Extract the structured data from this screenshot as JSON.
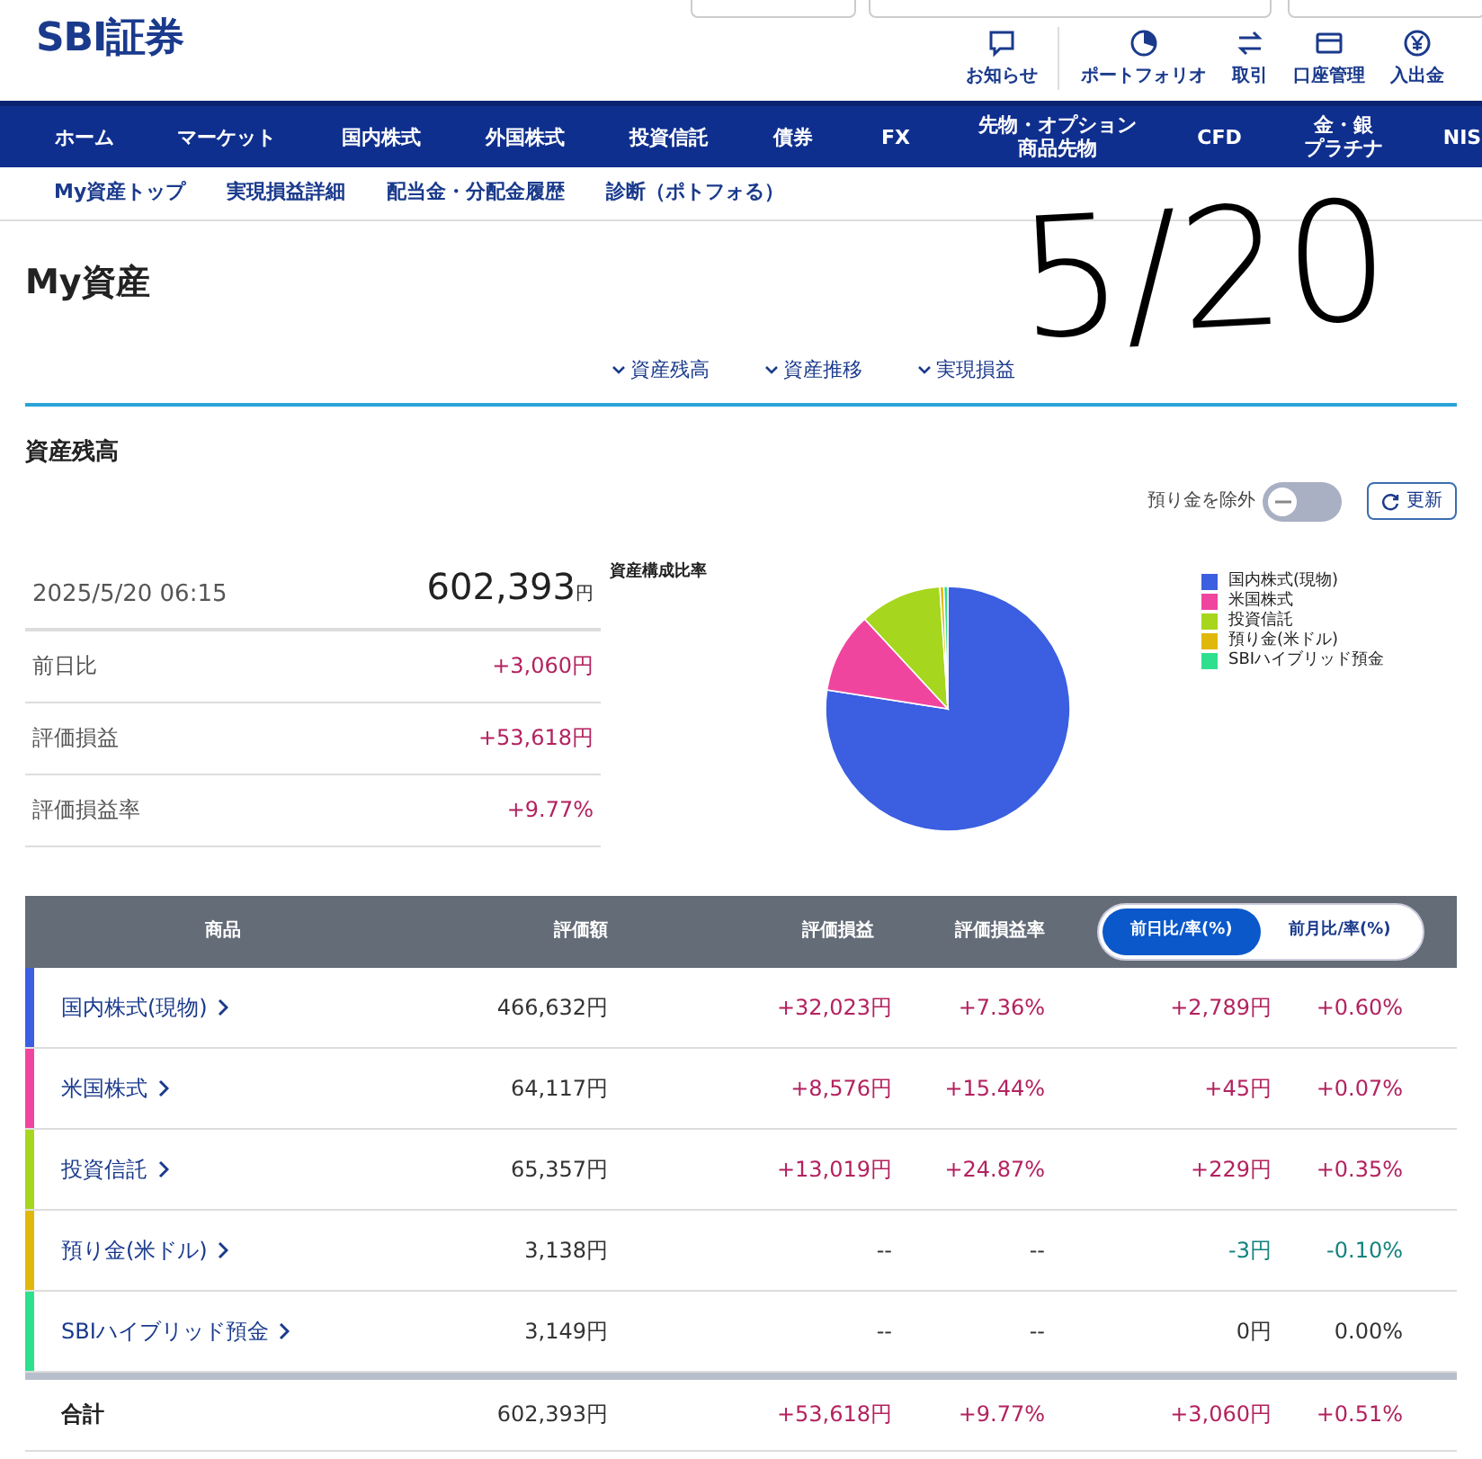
{
  "header": {
    "logo": "SBI証券",
    "icon_links": [
      {
        "label": "お知らせ"
      },
      {
        "label": "ポートフォリオ"
      },
      {
        "label": "取引"
      },
      {
        "label": "口座管理"
      },
      {
        "label": "入出金"
      }
    ]
  },
  "nav": [
    {
      "lines": [
        "ホーム"
      ]
    },
    {
      "lines": [
        "マーケット"
      ]
    },
    {
      "lines": [
        "国内株式"
      ]
    },
    {
      "lines": [
        "外国株式"
      ]
    },
    {
      "lines": [
        "投資信託"
      ]
    },
    {
      "lines": [
        "債券"
      ]
    },
    {
      "lines": [
        "FX"
      ]
    },
    {
      "lines": [
        "先物・オプション",
        "商品先物"
      ]
    },
    {
      "lines": [
        "CFD"
      ]
    },
    {
      "lines": [
        "金・銀",
        "プラチナ"
      ]
    },
    {
      "lines": [
        "NIS"
      ]
    }
  ],
  "subnav": [
    "My資産トップ",
    "実現損益詳細",
    "配当金・分配金履歴",
    "診断（ポトフォる）"
  ],
  "page_title": "My資産",
  "annotation": "5/20",
  "anchors": [
    "資産残高",
    "資産推移",
    "実現損益"
  ],
  "section_title": "資産残高",
  "summary": {
    "date": "2025/5/20 06:15",
    "total": "602,393",
    "total_unit": "円",
    "rows": [
      {
        "label": "前日比",
        "value": "+3,060円",
        "color": "#b3225f"
      },
      {
        "label": "評価損益",
        "value": "+53,618円",
        "color": "#b3225f"
      },
      {
        "label": "評価損益率",
        "value": "+9.77%",
        "color": "#b3225f"
      }
    ]
  },
  "exclude_toggle": {
    "label": "預り金を除外",
    "on": false
  },
  "refresh_button": "更新",
  "chart": {
    "title": "資産構成比率",
    "legend": [
      {
        "label": "国内株式(現物)",
        "color": "#3b5fe0"
      },
      {
        "label": "米国株式",
        "color": "#f0459f"
      },
      {
        "label": "投資信託",
        "color": "#a6d61e"
      },
      {
        "label": "預り金(米ドル)",
        "color": "#e0b80c"
      },
      {
        "label": "SBIハイブリッド預金",
        "color": "#2ee08e"
      }
    ]
  },
  "table": {
    "columns": [
      "商品",
      "評価額",
      "評価損益",
      "評価損益率"
    ],
    "period_tabs": [
      {
        "label": "前日比/率(%)",
        "selected": true
      },
      {
        "label": "前月比/率(%)",
        "selected": false
      }
    ],
    "rows": [
      {
        "name": "国内株式(現物)",
        "color": "#3b5fe0",
        "value": "466,632円",
        "gain": {
          "text": "+32,023円",
          "color": "#b3225f"
        },
        "gain_rate": {
          "text": "+7.36%",
          "color": "#b3225f"
        },
        "day": {
          "text": "+2,789円",
          "color": "#b3225f"
        },
        "day_rate": {
          "text": "+0.60%",
          "color": "#b3225f"
        }
      },
      {
        "name": "米国株式",
        "color": "#f0459f",
        "value": "64,117円",
        "gain": {
          "text": "+8,576円",
          "color": "#b3225f"
        },
        "gain_rate": {
          "text": "+15.44%",
          "color": "#b3225f"
        },
        "day": {
          "text": "+45円",
          "color": "#b3225f"
        },
        "day_rate": {
          "text": "+0.07%",
          "color": "#b3225f"
        }
      },
      {
        "name": "投資信託",
        "color": "#a6d61e",
        "value": "65,357円",
        "gain": {
          "text": "+13,019円",
          "color": "#b3225f"
        },
        "gain_rate": {
          "text": "+24.87%",
          "color": "#b3225f"
        },
        "day": {
          "text": "+229円",
          "color": "#b3225f"
        },
        "day_rate": {
          "text": "+0.35%",
          "color": "#b3225f"
        }
      },
      {
        "name": "預り金(米ドル)",
        "color": "#e0b80c",
        "value": "3,138円",
        "gain": {
          "text": "--",
          "color": "#333333"
        },
        "gain_rate": {
          "text": "--",
          "color": "#333333"
        },
        "day": {
          "text": "-3円",
          "color": "#14837f"
        },
        "day_rate": {
          "text": "-0.10%",
          "color": "#14837f"
        }
      },
      {
        "name": "SBIハイブリッド預金",
        "color": "#2ee08e",
        "value": "3,149円",
        "gain": {
          "text": "--",
          "color": "#333333"
        },
        "gain_rate": {
          "text": "--",
          "color": "#333333"
        },
        "day": {
          "text": "0円",
          "color": "#333333"
        },
        "day_rate": {
          "text": "0.00%",
          "color": "#333333"
        }
      }
    ],
    "total": {
      "name": "合計",
      "value": "602,393円",
      "gain": {
        "text": "+53,618円",
        "color": "#b3225f"
      },
      "gain_rate": {
        "text": "+9.77%",
        "color": "#b3225f"
      },
      "day": {
        "text": "+3,060円",
        "color": "#b3225f"
      },
      "day_rate": {
        "text": "+0.51%",
        "color": "#b3225f"
      }
    }
  }
}
